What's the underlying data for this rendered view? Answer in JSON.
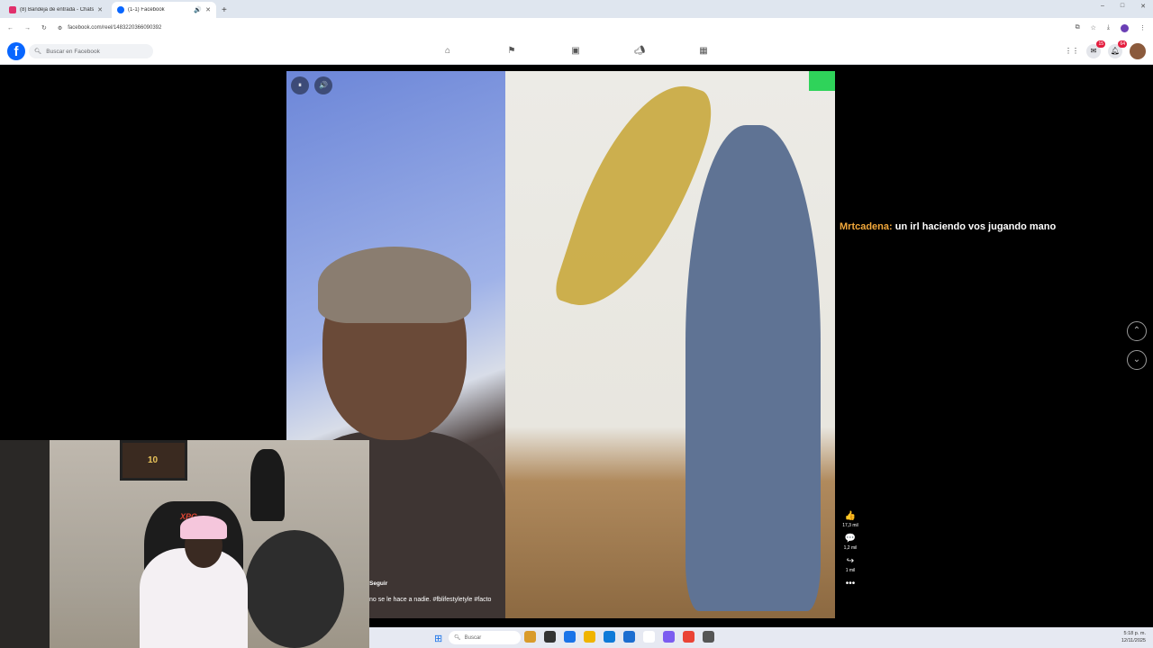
{
  "browser": {
    "tabs": [
      {
        "title": "(8) Bandeja de entrada - Chats",
        "color": "#e1306c",
        "active": false
      },
      {
        "title": "(1-1) Facebook",
        "color": "#0866ff",
        "active": true
      }
    ],
    "new_tab": "+",
    "url": "facebook.com/reel/1483220366090392",
    "window_controls": [
      "–",
      "□",
      "✕"
    ]
  },
  "facebook": {
    "logo": "f",
    "search_placeholder": "Buscar en Facebook",
    "nav_icons": [
      "home-icon",
      "flag-icon",
      "marketplace-icon",
      "megaphone-icon",
      "gaming-icon"
    ],
    "badges": {
      "messenger": "15",
      "notifications": "64"
    }
  },
  "video": {
    "pause_icon": "⏸",
    "volume_icon": "🔊",
    "follow_label": "Seguir",
    "caption": "no se le hace a nadie. #fblifestyletyle #facto"
  },
  "chat_overlay": {
    "username": "Mrtcadena:",
    "message": "un irl haciendo vos jugando mano"
  },
  "reel_actions": [
    {
      "name": "like",
      "icon": "👍",
      "count": "17,3 mil"
    },
    {
      "name": "comment",
      "icon": "💬",
      "count": "1,2 mil"
    },
    {
      "name": "share",
      "icon": "↪",
      "count": "1 mil"
    }
  ],
  "more_label": "•••",
  "taskbar": {
    "search_placeholder": "Buscar",
    "time": "5:18 p. m.",
    "date": "12/11/2025",
    "app_colors": [
      "#d99b2b",
      "#333333",
      "#1a73e8",
      "#f0b400",
      "#0e7ad8",
      "#1c6dd0",
      "#ffffff",
      "#7b5cf0",
      "#ea4335",
      "#555555"
    ]
  },
  "webcam_overlay": {
    "jersey_number": "10",
    "chair_brand": "XPG"
  }
}
